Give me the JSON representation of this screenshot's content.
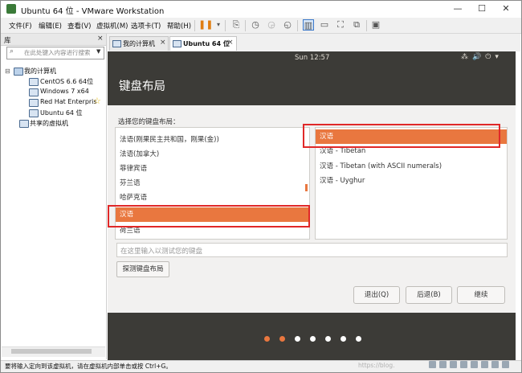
{
  "window": {
    "title": "Ubuntu 64 位 - VMware Workstation",
    "controls": [
      "—",
      "☐",
      "✕"
    ]
  },
  "menu": {
    "items": [
      "文件(F)",
      "编辑(E)",
      "查看(V)",
      "虚拟机(M)",
      "选项卡(T)",
      "帮助(H)"
    ]
  },
  "library": {
    "title": "库",
    "close": "×",
    "search_placeholder": "在此处键入内容进行搜索",
    "tree": {
      "root": "我的计算机",
      "vms": [
        "CentOS 6.6 64位",
        "Windows 7 x64",
        "Red Hat Enterpris",
        "Ubuntu 64 位"
      ],
      "shared": "共享的虚拟机"
    }
  },
  "tabs": [
    {
      "label": "我的计算机",
      "close": "×"
    },
    {
      "label": "Ubuntu 64 位",
      "close": "×"
    }
  ],
  "guest": {
    "clock": "Sun 12:57",
    "page_title": "键盘布局",
    "prompt": "选择您的键盘布局：",
    "layouts": [
      "法语(刚果民主共和国，刚果(金))",
      "法语(加拿大)",
      "菲律宾语",
      "芬兰语",
      "哈萨克语",
      "汉语",
      "荷兰语"
    ],
    "layouts_selected": "汉语",
    "variants": [
      "汉语",
      "汉语 - Tibetan",
      "汉语 - Tibetan (with ASCII numerals)",
      "汉语 - Uyghur"
    ],
    "variants_selected": "汉语",
    "test_placeholder": "在这里输入以测试您的键盘",
    "detect_button": "探测键盘布局",
    "quit_button": "退出(Q)",
    "back_button": "后退(B)",
    "continue_button": "继续",
    "progress_step": 2,
    "progress_total": 7
  },
  "status": {
    "text": "要将输入定向到该虚拟机，请在虚拟机内部单击或按 Ctrl+G。",
    "watermark": "https://blog."
  },
  "colors": {
    "accent": "#e9773f",
    "guest_dark": "#3c3b37",
    "highlight_box": "#e02828"
  }
}
